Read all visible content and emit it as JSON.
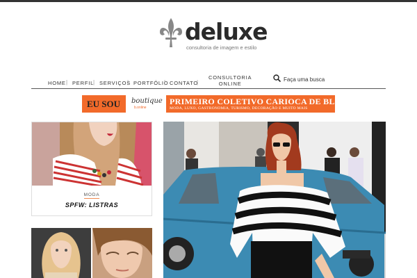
{
  "brand": {
    "name": "deluxe",
    "tagline": "consultoria de imagem e estilo"
  },
  "nav": {
    "items": [
      {
        "label": "HOME"
      },
      {
        "label": "PERFIL"
      },
      {
        "label": "SERVIÇOS"
      },
      {
        "label": "PORTFÓLIO"
      },
      {
        "label": "CONTATO"
      }
    ],
    "consultoria_line1": "CONSULTORIA",
    "consultoria_line2": "ONLINE",
    "separator": "|"
  },
  "search": {
    "placeholder": "Faça uma busca",
    "icon": "search-icon"
  },
  "banner": {
    "eu_sou": "EU SOU",
    "boutique": "boutique",
    "boutique_sub": "b.online",
    "title": "PRIMEIRO COLETIVO CARIOCA DE BLOGS",
    "subtitle": "MODA, LUXO, GASTRONOMIA, TURISMO, DECORAÇÃO E MUITO MAIS",
    "color": "#f26a2a"
  },
  "posts": [
    {
      "category": "MODA",
      "title": "SPFW: LISTRAS"
    }
  ],
  "colors": {
    "accent": "#f26a2a",
    "text": "#2a2a2a"
  }
}
